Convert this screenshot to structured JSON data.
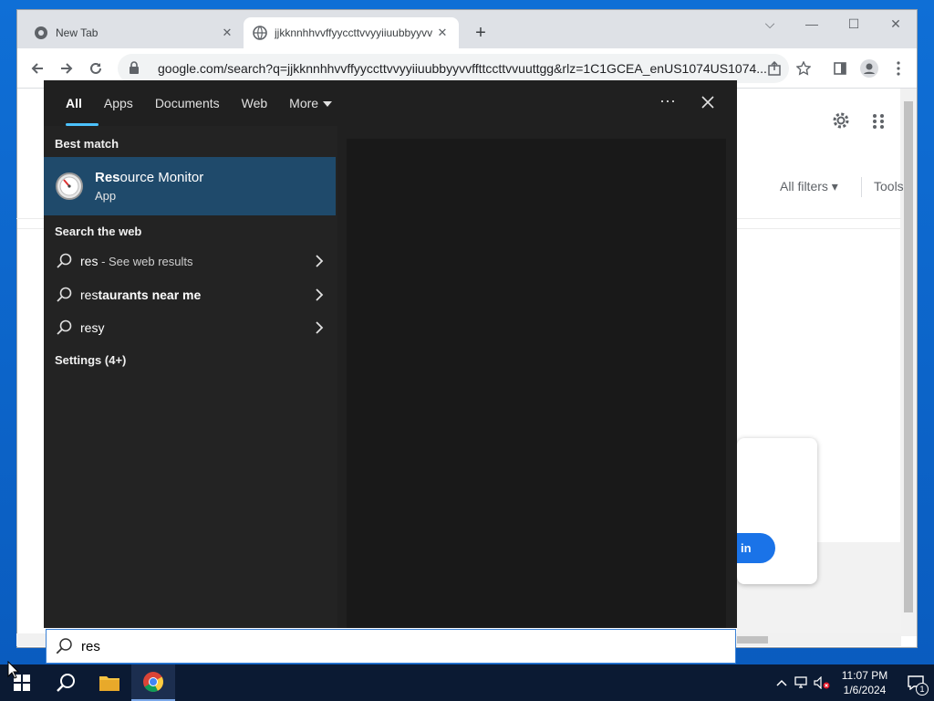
{
  "browser": {
    "tabs": [
      {
        "title": "New Tab",
        "active": false
      },
      {
        "title": "jjkknnhhvvffyycсttvvyyiiuubbyyvv",
        "active": true
      }
    ],
    "url": "google.com/search?q=jjkknnhhvvffyycсttvvyyiiuubbyyvvffttccttvvuuttgg&rlz=1C1GCEA_enUS1074US1074..."
  },
  "google": {
    "all_filters": "All filters",
    "tools": "Tools",
    "sign_in": "in"
  },
  "search_panel": {
    "tabs": [
      "All",
      "Apps",
      "Documents",
      "Web",
      "More"
    ],
    "best_match_heading": "Best match",
    "best_match": {
      "name_bold": "Res",
      "name_rest": "ource Monitor",
      "type": "App"
    },
    "web_heading": "Search the web",
    "web_results": [
      {
        "bold": "res",
        "rest": "",
        "sub": " - See web results"
      },
      {
        "bold": "res",
        "rest": "taurants near me",
        "sub": ""
      },
      {
        "bold": "res",
        "rest": "y",
        "sub": ""
      }
    ],
    "settings_heading": "Settings (4+)",
    "query": "res"
  },
  "taskbar": {
    "time": "11:07 PM",
    "date": "1/6/2024",
    "notification_count": "1"
  },
  "colors": {
    "accent": "#4cc2ff",
    "best_match_bg": "#1f4a6b",
    "panel_bg": "#202020"
  }
}
